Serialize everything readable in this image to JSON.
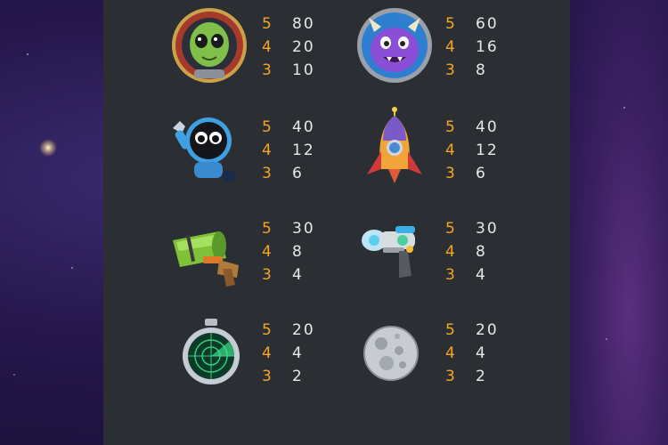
{
  "paytable": [
    {
      "symbol": "alien-astronaut-icon",
      "pays": [
        {
          "count": "5",
          "value": "80"
        },
        {
          "count": "4",
          "value": "20"
        },
        {
          "count": "3",
          "value": "10"
        }
      ]
    },
    {
      "symbol": "purple-monster-icon",
      "pays": [
        {
          "count": "5",
          "value": "60"
        },
        {
          "count": "4",
          "value": "16"
        },
        {
          "count": "3",
          "value": "8"
        }
      ]
    },
    {
      "symbol": "robot-icon",
      "pays": [
        {
          "count": "5",
          "value": "40"
        },
        {
          "count": "4",
          "value": "12"
        },
        {
          "count": "3",
          "value": "6"
        }
      ]
    },
    {
      "symbol": "rocket-icon",
      "pays": [
        {
          "count": "5",
          "value": "40"
        },
        {
          "count": "4",
          "value": "12"
        },
        {
          "count": "3",
          "value": "6"
        }
      ]
    },
    {
      "symbol": "green-blaster-icon",
      "pays": [
        {
          "count": "5",
          "value": "30"
        },
        {
          "count": "4",
          "value": "8"
        },
        {
          "count": "3",
          "value": "4"
        }
      ]
    },
    {
      "symbol": "ray-gun-icon",
      "pays": [
        {
          "count": "5",
          "value": "30"
        },
        {
          "count": "4",
          "value": "8"
        },
        {
          "count": "3",
          "value": "4"
        }
      ]
    },
    {
      "symbol": "radar-icon",
      "pays": [
        {
          "count": "5",
          "value": "20"
        },
        {
          "count": "4",
          "value": "4"
        },
        {
          "count": "3",
          "value": "2"
        }
      ]
    },
    {
      "symbol": "moon-icon",
      "pays": [
        {
          "count": "5",
          "value": "20"
        },
        {
          "count": "4",
          "value": "4"
        },
        {
          "count": "3",
          "value": "2"
        }
      ]
    }
  ],
  "colors": {
    "panel": "#2b2e33",
    "count": "#f5a623",
    "value": "#e8e8e8"
  }
}
